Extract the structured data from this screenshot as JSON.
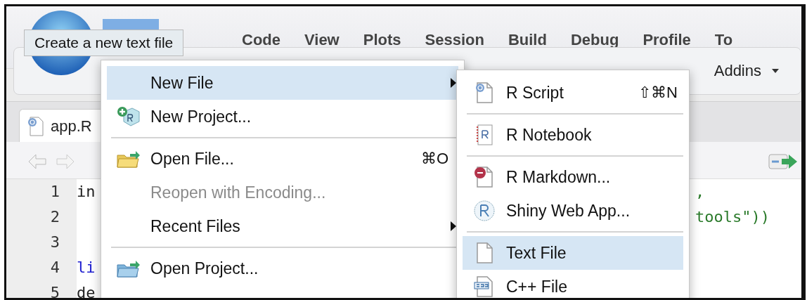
{
  "menubar": [
    {
      "label": "Code"
    },
    {
      "label": "View"
    },
    {
      "label": "Plots"
    },
    {
      "label": "Session"
    },
    {
      "label": "Build"
    },
    {
      "label": "Debug"
    },
    {
      "label": "Profile"
    },
    {
      "label": "To"
    }
  ],
  "tooltip": "Create a new text file",
  "toolbar": {
    "addins": "Addins"
  },
  "tab": {
    "label": "app.R"
  },
  "code_lines": [
    {
      "number": "1",
      "text": "in",
      "tail": ","
    },
    {
      "number": "2",
      "tail": "tools\"))"
    },
    {
      "number": "3"
    },
    {
      "number": "4",
      "text": "li"
    },
    {
      "number": "5",
      "text": "de"
    }
  ],
  "file_menu": {
    "items": [
      {
        "kind": "item",
        "label": "New File",
        "submenu": true,
        "selected": true,
        "disabled": false
      },
      {
        "kind": "item",
        "label": "New Project...",
        "submenu": false,
        "selected": false,
        "disabled": false
      },
      {
        "kind": "separator"
      },
      {
        "kind": "item",
        "label": "Open File...",
        "shortcut": "⌘O",
        "submenu": false,
        "selected": false,
        "disabled": false
      },
      {
        "kind": "item",
        "label": "Reopen with Encoding...",
        "submenu": false,
        "selected": false,
        "disabled": true
      },
      {
        "kind": "item",
        "label": "Recent Files",
        "submenu": true,
        "selected": false,
        "disabled": false
      },
      {
        "kind": "separator"
      },
      {
        "kind": "item",
        "label": "Open Project...",
        "submenu": false,
        "selected": false,
        "disabled": false
      }
    ]
  },
  "new_file_menu": {
    "items": [
      {
        "kind": "item",
        "label": "R Script",
        "shortcut": "⇧⌘N",
        "selected": false
      },
      {
        "kind": "separator"
      },
      {
        "kind": "item",
        "label": "R Notebook",
        "selected": false
      },
      {
        "kind": "separator"
      },
      {
        "kind": "item",
        "label": "R Markdown...",
        "selected": false
      },
      {
        "kind": "item",
        "label": "Shiny Web App...",
        "selected": false
      },
      {
        "kind": "separator"
      },
      {
        "kind": "item",
        "label": "Text File",
        "selected": true
      },
      {
        "kind": "item",
        "label": "C++ File",
        "selected": false
      }
    ]
  }
}
